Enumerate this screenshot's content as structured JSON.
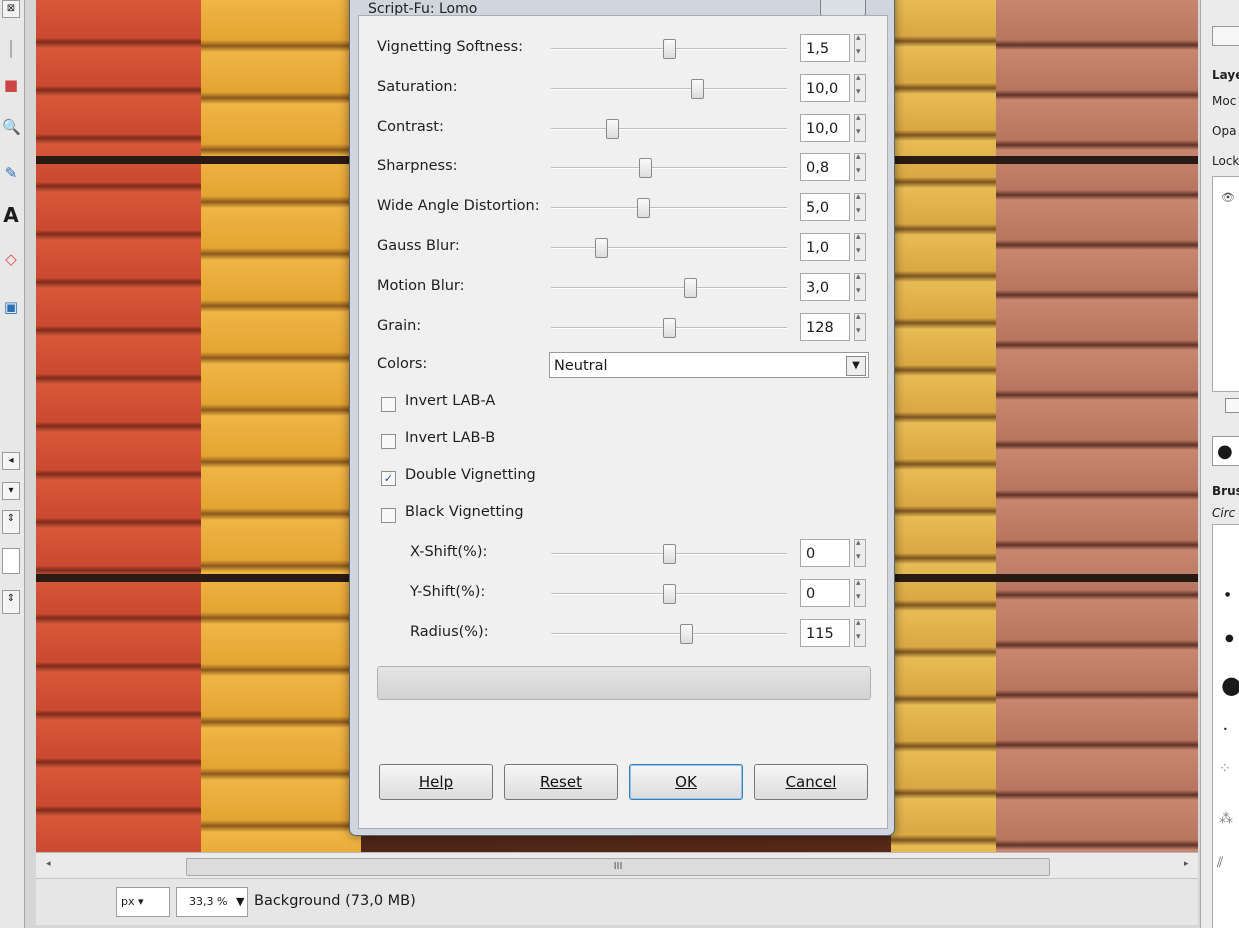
{
  "dialog": {
    "title": "Script-Fu: Lomo",
    "sliders": [
      {
        "label": "Vignetting Softness:",
        "value": "1,5",
        "level": 0.5
      },
      {
        "label": "Saturation:",
        "value": "10,0",
        "level": 0.62
      },
      {
        "label": "Contrast:",
        "value": "10,0",
        "level": 0.26
      },
      {
        "label": "Sharpness:",
        "value": "0,8",
        "level": 0.4
      },
      {
        "label": "Wide Angle Distortion:",
        "value": "5,0",
        "level": 0.39
      },
      {
        "label": "Gauss Blur:",
        "value": "1,0",
        "level": 0.21
      },
      {
        "label": "Motion Blur:",
        "value": "3,0",
        "level": 0.59
      },
      {
        "label": "Grain:",
        "value": "128",
        "level": 0.5
      }
    ],
    "colors": {
      "label": "Colors:",
      "value": "Neutral"
    },
    "checkboxes": [
      {
        "label": "Invert LAB-A",
        "checked": false
      },
      {
        "label": "Invert LAB-B",
        "checked": false
      },
      {
        "label": "Double Vignetting",
        "checked": true
      },
      {
        "label": "Black Vignetting",
        "checked": false
      }
    ],
    "sub_sliders": [
      {
        "label": "X-Shift(%):",
        "value": "0",
        "level": 0.5
      },
      {
        "label": "Y-Shift(%):",
        "value": "0",
        "level": 0.5
      },
      {
        "label": "Radius(%):",
        "value": "115",
        "level": 0.57
      }
    ],
    "buttons": {
      "help": "Help",
      "reset": "Reset",
      "ok": "OK",
      "cancel": "Cancel"
    }
  },
  "statusbar": {
    "unit": "px",
    "zoom": "33,3 %",
    "info": "Background (73,0 MB)"
  },
  "scrollbar": {
    "grip": "III"
  },
  "rightdock": {
    "labels": [
      "Laye",
      "Moc",
      "Opa",
      "Lock",
      "Brus",
      "Circ"
    ]
  }
}
